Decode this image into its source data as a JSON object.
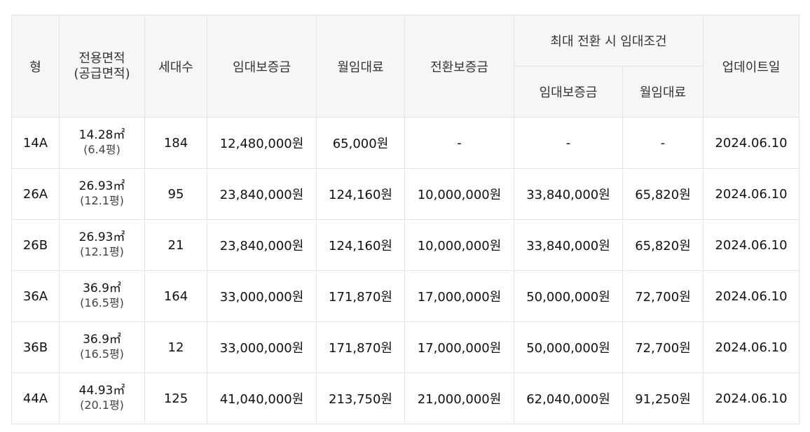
{
  "table": {
    "headers": {
      "type": "형",
      "area_line1": "전용면적",
      "area_line2": "(공급면적)",
      "households": "세대수",
      "deposit": "임대보증금",
      "monthly": "월임대료",
      "conversion": "전환보증금",
      "max_conversion_group": "최대 전환 시 임대조건",
      "max_deposit": "임대보증금",
      "max_monthly": "월임대료",
      "updated": "업데이트일"
    },
    "rows": [
      {
        "type": "14A",
        "area": "14.28㎡",
        "area_sub": "(6.4평)",
        "households": "184",
        "deposit": "12,480,000원",
        "monthly": "65,000원",
        "conversion": "-",
        "max_deposit": "-",
        "max_monthly": "-",
        "updated": "2024.06.10"
      },
      {
        "type": "26A",
        "area": "26.93㎡",
        "area_sub": "(12.1평)",
        "households": "95",
        "deposit": "23,840,000원",
        "monthly": "124,160원",
        "conversion": "10,000,000원",
        "max_deposit": "33,840,000원",
        "max_monthly": "65,820원",
        "updated": "2024.06.10"
      },
      {
        "type": "26B",
        "area": "26.93㎡",
        "area_sub": "(12.1평)",
        "households": "21",
        "deposit": "23,840,000원",
        "monthly": "124,160원",
        "conversion": "10,000,000원",
        "max_deposit": "33,840,000원",
        "max_monthly": "65,820원",
        "updated": "2024.06.10"
      },
      {
        "type": "36A",
        "area": "36.9㎡",
        "area_sub": "(16.5평)",
        "households": "164",
        "deposit": "33,000,000원",
        "monthly": "171,870원",
        "conversion": "17,000,000원",
        "max_deposit": "50,000,000원",
        "max_monthly": "72,700원",
        "updated": "2024.06.10"
      },
      {
        "type": "36B",
        "area": "36.9㎡",
        "area_sub": "(16.5평)",
        "households": "12",
        "deposit": "33,000,000원",
        "monthly": "171,870원",
        "conversion": "17,000,000원",
        "max_deposit": "50,000,000원",
        "max_monthly": "72,700원",
        "updated": "2024.06.10"
      },
      {
        "type": "44A",
        "area": "44.93㎡",
        "area_sub": "(20.1평)",
        "households": "125",
        "deposit": "41,040,000원",
        "monthly": "213,750원",
        "conversion": "21,000,000원",
        "max_deposit": "62,040,000원",
        "max_monthly": "91,250원",
        "updated": "2024.06.10"
      }
    ]
  }
}
